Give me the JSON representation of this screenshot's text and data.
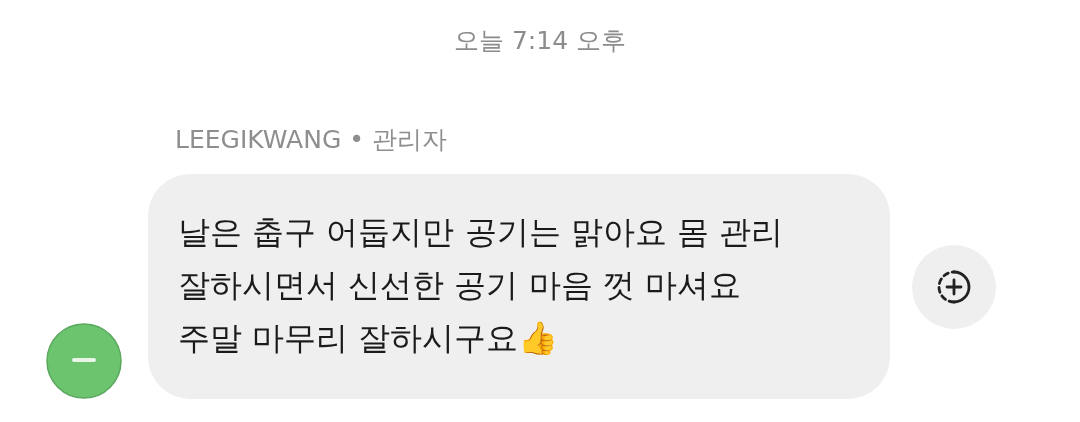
{
  "timestamp": "오늘 7:14 오후",
  "message": {
    "sender": "LEEGIKWANG",
    "separator": "•",
    "role": "관리자",
    "lines": [
      "날은 춥구 어둡지만 공기는 맑아요 몸 관리",
      "잘하시면서 신선한 공기 마음 껏 마셔요",
      "주말 마무리 잘하시구요👍"
    ]
  }
}
